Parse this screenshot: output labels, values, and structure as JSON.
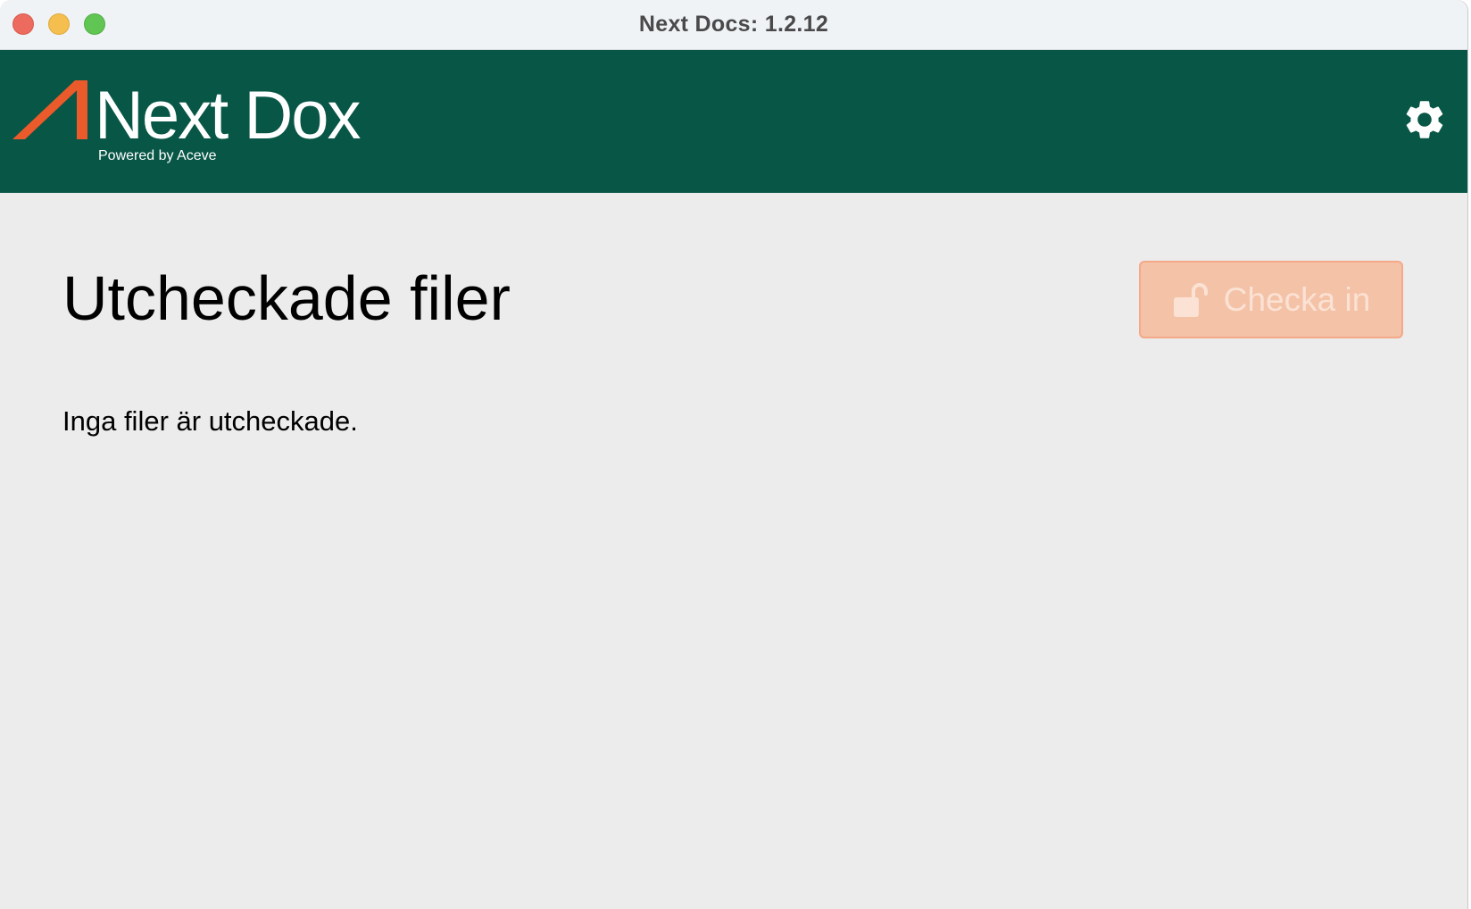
{
  "window": {
    "title": "Next Docs: 1.2.12"
  },
  "header": {
    "logo": {
      "name_primary": "Next",
      "name_secondary": "Dox",
      "tagline": "Powered by Aceve"
    },
    "background_color": "#075646",
    "accent_color": "#ea5a2a",
    "settings_icon": "gear-icon"
  },
  "main": {
    "page_title": "Utcheckade filer",
    "checkin_button": {
      "label": "Checka in",
      "icon": "unlock-icon",
      "state": "disabled"
    },
    "empty_message": "Inga filer är utcheckade."
  }
}
